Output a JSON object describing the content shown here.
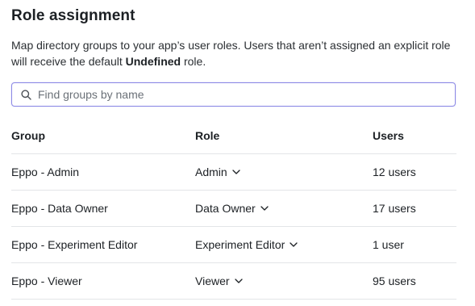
{
  "title": "Role assignment",
  "description": {
    "before": "Map directory groups to your app’s user roles. Users that aren’t assigned an explicit role will receive the default ",
    "strong": "Undefined",
    "after": " role."
  },
  "search": {
    "placeholder": "Find groups by name",
    "value": "",
    "icon": "search-icon"
  },
  "table": {
    "headers": {
      "group": "Group",
      "role": "Role",
      "users": "Users"
    },
    "rows": [
      {
        "group": "Eppo - Admin",
        "role": "Admin",
        "users": "12 users"
      },
      {
        "group": "Eppo - Data Owner",
        "role": "Data Owner",
        "users": "17 users"
      },
      {
        "group": "Eppo - Experiment Editor",
        "role": "Experiment Editor",
        "users": "1 user"
      },
      {
        "group": "Eppo - Viewer",
        "role": "Viewer",
        "users": "95 users"
      }
    ]
  },
  "colors": {
    "focus_border": "#8d8ae6",
    "divider": "#e3e5e8",
    "text": "#1c2024"
  }
}
